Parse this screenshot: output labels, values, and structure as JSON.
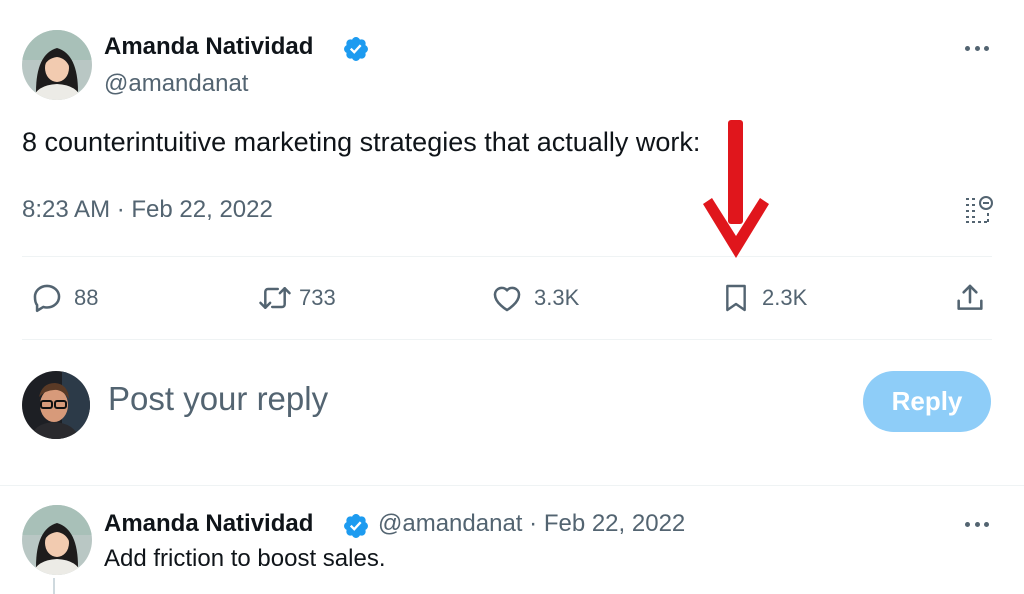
{
  "tweet": {
    "author_name": "Amanda Natividad",
    "author_handle": "@amandanat",
    "text": "8 counterintuitive marketing strategies that actually work:",
    "timestamp": "8:23 AM · Feb 22, 2022",
    "stats": {
      "replies": "88",
      "retweets": "733",
      "likes": "3.3K",
      "bookmarks": "2.3K"
    }
  },
  "composer": {
    "placeholder": "Post your reply",
    "reply_label": "Reply"
  },
  "reply_tweet": {
    "author_name": "Amanda Natividad",
    "author_handle": "@amandanat",
    "separator": "·",
    "date": "Feb 22, 2022",
    "text": "Add friction to boost sales."
  },
  "icons": {
    "verified": "verified-badge-icon",
    "more": "more-icon",
    "analytics": "analytics-icon",
    "reply": "reply-icon",
    "retweet": "retweet-icon",
    "like": "heart-icon",
    "bookmark": "bookmark-icon",
    "share": "share-icon",
    "annotation_arrow": "red-arrow-icon"
  },
  "colors": {
    "verified": "#1d9bf0",
    "secondary_text": "#536471",
    "reply_button": "#8ecdf8",
    "annotation_arrow": "#e0161c"
  }
}
